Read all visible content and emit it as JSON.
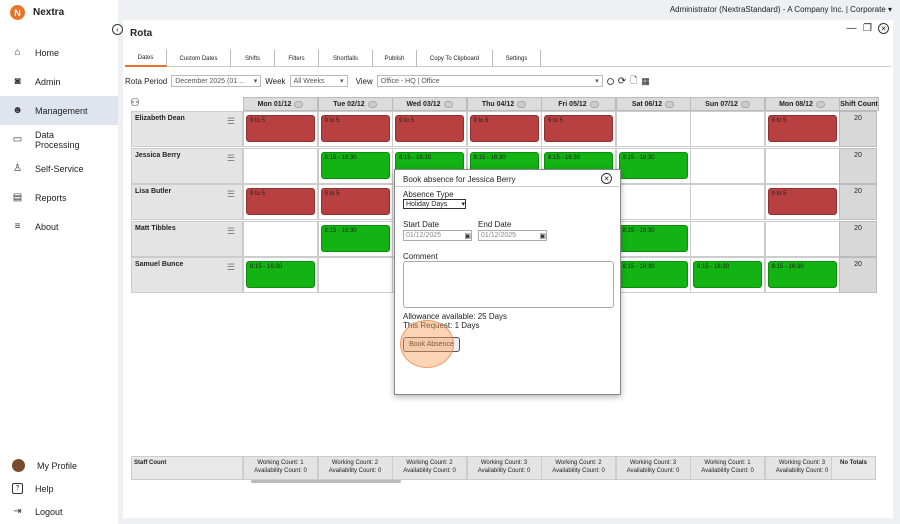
{
  "app": {
    "name": "Nextra",
    "logo_letter": "N"
  },
  "sidebar": {
    "items": [
      {
        "label": "Home",
        "icon": "home-icon"
      },
      {
        "label": "Admin",
        "icon": "camera-icon"
      },
      {
        "label": "Management",
        "icon": "people-icon",
        "active": true
      },
      {
        "label": "Data Processing",
        "icon": "folder-icon"
      },
      {
        "label": "Self-Service",
        "icon": "person-icon"
      },
      {
        "label": "Reports",
        "icon": "report-icon"
      },
      {
        "label": "About",
        "icon": "menu-icon"
      }
    ],
    "bottom": [
      {
        "label": "My Profile",
        "icon": "avatar"
      },
      {
        "label": "Help",
        "icon": "help-icon"
      },
      {
        "label": "Logout",
        "icon": "logout-icon"
      }
    ]
  },
  "topbar": {
    "tenant": "Administrator (NextraStandard) - A Company Inc. | Corporate ▾"
  },
  "panel": {
    "title": "Rota"
  },
  "tabs": [
    "Dates",
    "Custom Dates",
    "Shifts",
    "Filters",
    "Shortfalls",
    "Publish",
    "Copy To Clipboard",
    "Settings"
  ],
  "filters": {
    "rota_period_label": "Rota Period",
    "rota_period_value": "December 2025 (01 ...",
    "week_label": "Week",
    "week_value": "All Weeks",
    "view_label": "View",
    "view_value": "Office - HQ | Office"
  },
  "grid": {
    "days": [
      "Mon 01/12",
      "Tue 02/12",
      "Wed 03/12",
      "Thu 04/12",
      "Fri 05/12",
      "Sat 06/12",
      "Sun 07/12",
      "Mon 08/12"
    ],
    "shift_count_header": "Shift Count",
    "rows": [
      {
        "name": "Elizabeth Dean",
        "count": "20",
        "shifts": [
          {
            "t": "9 to 5",
            "c": "red"
          },
          {
            "t": "9 to 5",
            "c": "red"
          },
          {
            "t": "9 to 5",
            "c": "red"
          },
          {
            "t": "9 to 5",
            "c": "red"
          },
          {
            "t": "9 to 5",
            "c": "red"
          },
          null,
          null,
          {
            "t": "9 to 5",
            "c": "red"
          }
        ]
      },
      {
        "name": "Jessica Berry",
        "count": "20",
        "shifts": [
          null,
          {
            "t": "8:15 - 16:30",
            "c": "green"
          },
          {
            "t": "8:15 - 16:30",
            "c": "green"
          },
          {
            "t": "8:15 - 16:30",
            "c": "green"
          },
          {
            "t": "8:15 - 16:30",
            "c": "green"
          },
          {
            "t": "8:15 - 16:30",
            "c": "green"
          },
          null,
          null
        ]
      },
      {
        "name": "Lisa Butler",
        "count": "20",
        "shifts": [
          {
            "t": "9 to 5",
            "c": "red"
          },
          {
            "t": "9 to 5",
            "c": "red"
          },
          null,
          null,
          null,
          null,
          null,
          {
            "t": "9 to 5",
            "c": "red"
          }
        ]
      },
      {
        "name": "Matt Tibbles",
        "count": "20",
        "shifts": [
          null,
          {
            "t": "8:15 - 16:30",
            "c": "green"
          },
          null,
          null,
          null,
          {
            "t": "8:15 - 16:30",
            "c": "green"
          },
          null,
          null
        ]
      },
      {
        "name": "Samuel Bunce",
        "count": "20",
        "shifts": [
          {
            "t": "8:15 - 16:30",
            "c": "green"
          },
          null,
          null,
          null,
          null,
          {
            "t": "8:15 - 16:30",
            "c": "green"
          },
          {
            "t": "8:15 - 16:30",
            "c": "green"
          },
          {
            "t": "8:15 - 16:30",
            "c": "green"
          }
        ]
      }
    ]
  },
  "footer": {
    "staff_count_label": "Staff Count",
    "cells": [
      [
        "Working Count: 1",
        "Availability Count: 0"
      ],
      [
        "Working Count: 2",
        "Availability Count: 0"
      ],
      [
        "Working Count: 2",
        "Availability Count: 0"
      ],
      [
        "Working Count: 3",
        "Availability Count: 0"
      ],
      [
        "Working Count: 2",
        "Availability Count: 0"
      ],
      [
        "Working Count: 3",
        "Availability Count: 0"
      ],
      [
        "Working Count: 1",
        "Availability Count: 0"
      ],
      [
        "Working Count: 3",
        "Availability Count: 0"
      ]
    ],
    "no_totals": "No Totals"
  },
  "modal": {
    "title": "Book absence for Jessica Berry",
    "absence_type_label": "Absence Type",
    "absence_type_value": "Holiday Days",
    "start_date_label": "Start Date",
    "start_date_value": "01/12/2025",
    "end_date_label": "End Date",
    "end_date_value": "01/12/2025",
    "comment_label": "Comment",
    "allowance": "Allowance available: 25 Days",
    "this_request": "This Request: 1 Days",
    "book_button": "Book Absence"
  },
  "colors": {
    "accent": "#e8742a",
    "absence": "#b84040",
    "shift": "#12b312"
  }
}
